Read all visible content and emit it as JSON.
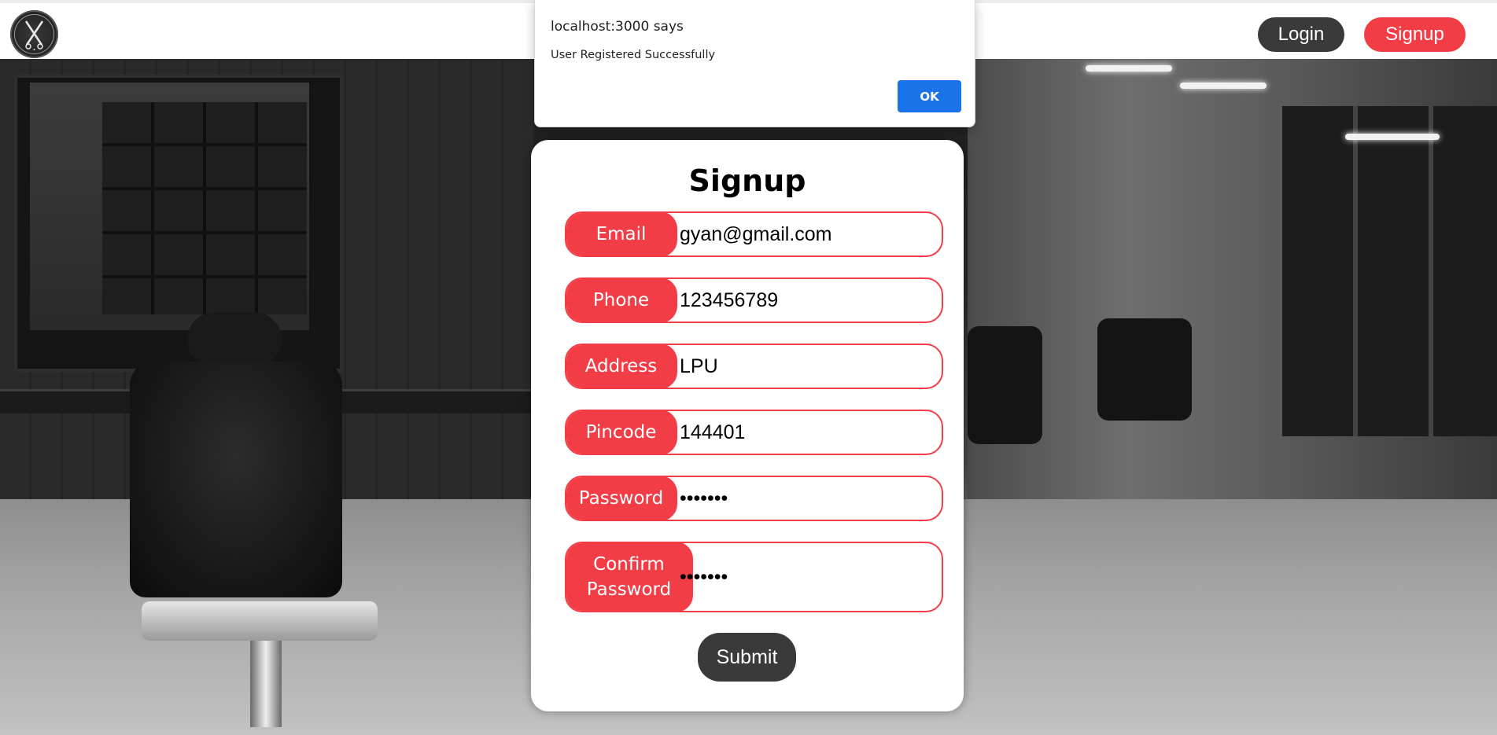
{
  "navbar": {
    "logo_icon": "barber-scissors-logo-icon",
    "login_label": "Login",
    "signup_label": "Signup",
    "colors": {
      "login_bg": "#3a3a3a",
      "signup_bg": "#f23c46"
    }
  },
  "form": {
    "title": "Signup",
    "fields": [
      {
        "label": "Email",
        "value": "gyan@gmail.com",
        "type": "text"
      },
      {
        "label": "Phone",
        "value": "123456789",
        "type": "text"
      },
      {
        "label": "Address",
        "value": "LPU",
        "type": "text"
      },
      {
        "label": "Pincode",
        "value": "144401",
        "type": "text"
      },
      {
        "label": "Password",
        "value": "1234567",
        "type": "password"
      },
      {
        "label": "Confirm Password",
        "value": "1234567",
        "type": "password"
      }
    ],
    "submit_label": "Submit",
    "accent_color": "#f23c46"
  },
  "alert": {
    "origin": "localhost:3000 says",
    "message": "User Registered Successfully",
    "ok_label": "OK",
    "button_color": "#1a73e8"
  }
}
